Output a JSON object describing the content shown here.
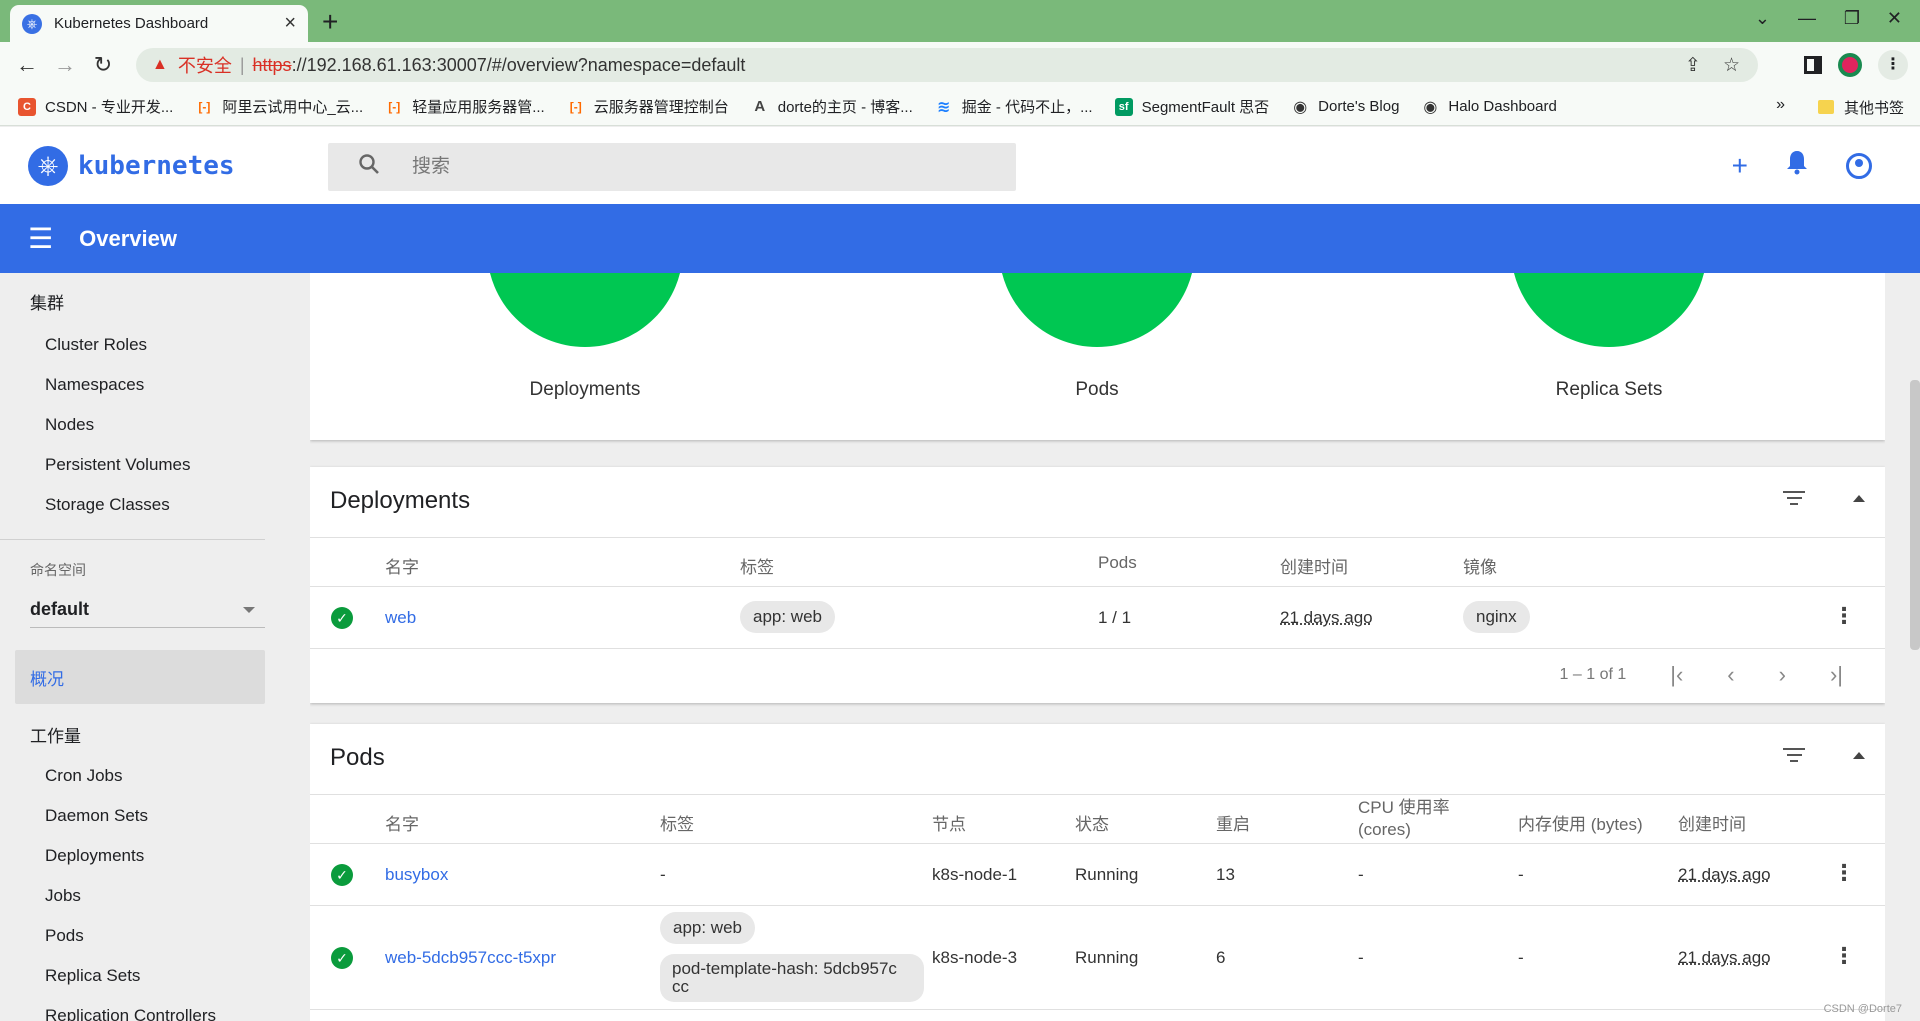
{
  "browser": {
    "tab_title": "Kubernetes Dashboard",
    "insecure_label": "不安全",
    "url_protocol": "https",
    "url_rest": "://192.168.61.163:30007/#/overview?namespace=default",
    "bookmarks": [
      {
        "label": "CSDN - 专业开发...",
        "color": "#e8542f",
        "glyph": "C"
      },
      {
        "label": "阿里云试用中心_云...",
        "color": "#ff6a00",
        "glyph": "[-]"
      },
      {
        "label": "轻量应用服务器管...",
        "color": "#ff6a00",
        "glyph": "[-]"
      },
      {
        "label": "云服务器管理控制台",
        "color": "#ff6a00",
        "glyph": "[-]"
      },
      {
        "label": "dorte的主页 - 博客...",
        "color": "#444444",
        "glyph": "A"
      },
      {
        "label": "掘金 - 代码不止，...",
        "color": "#1e80ff",
        "glyph": "≋"
      },
      {
        "label": "SegmentFault 思否",
        "color": "#009a61",
        "glyph": "sf"
      },
      {
        "label": "Dorte's Blog",
        "color": "#333333",
        "glyph": "◉"
      },
      {
        "label": "Halo Dashboard",
        "color": "#333333",
        "glyph": "◉"
      }
    ],
    "more_bookmarks": "»",
    "other_bookmarks": "其他书签"
  },
  "header": {
    "logo_text": "kubernetes",
    "search_placeholder": "搜索",
    "page_title": "Overview"
  },
  "sidebar": {
    "cluster_heading": "集群",
    "cluster_items": [
      "Cluster Roles",
      "Namespaces",
      "Nodes",
      "Persistent Volumes",
      "Storage Classes"
    ],
    "namespace_label": "命名空间",
    "namespace_value": "default",
    "overview_label": "概况",
    "workloads_heading": "工作量",
    "workload_items": [
      "Cron Jobs",
      "Daemon Sets",
      "Deployments",
      "Jobs",
      "Pods",
      "Replica Sets",
      "Replication Controllers"
    ]
  },
  "status": {
    "labels": [
      "Deployments",
      "Pods",
      "Replica Sets"
    ],
    "color": "#00c752"
  },
  "deployments": {
    "title": "Deployments",
    "columns": [
      "名字",
      "标签",
      "Pods",
      "创建时间",
      "镜像"
    ],
    "rows": [
      {
        "name": "web",
        "label": "app: web",
        "pods": "1 / 1",
        "created": "21 days ago",
        "image": "nginx"
      }
    ],
    "pagination": "1 – 1 of 1"
  },
  "pods": {
    "title": "Pods",
    "columns": [
      "名字",
      "标签",
      "节点",
      "状态",
      "重启",
      "CPU 使用率 (cores)",
      "内存使用 (bytes)",
      "创建时间"
    ],
    "rows": [
      {
        "name": "busybox",
        "label": "-",
        "node": "k8s-node-1",
        "status": "Running",
        "restarts": "13",
        "cpu": "-",
        "memory": "-",
        "created": "21 days ago"
      },
      {
        "name": "web-5dcb957ccc-t5xpr",
        "labels": [
          "app: web",
          "pod-template-hash: 5dcb957c cc"
        ],
        "node": "k8s-node-3",
        "status": "Running",
        "restarts": "6",
        "cpu": "-",
        "memory": "-",
        "created": "21 days ago"
      }
    ]
  },
  "watermark": "CSDN @Dorte7",
  "accent_color": "#326ce5"
}
